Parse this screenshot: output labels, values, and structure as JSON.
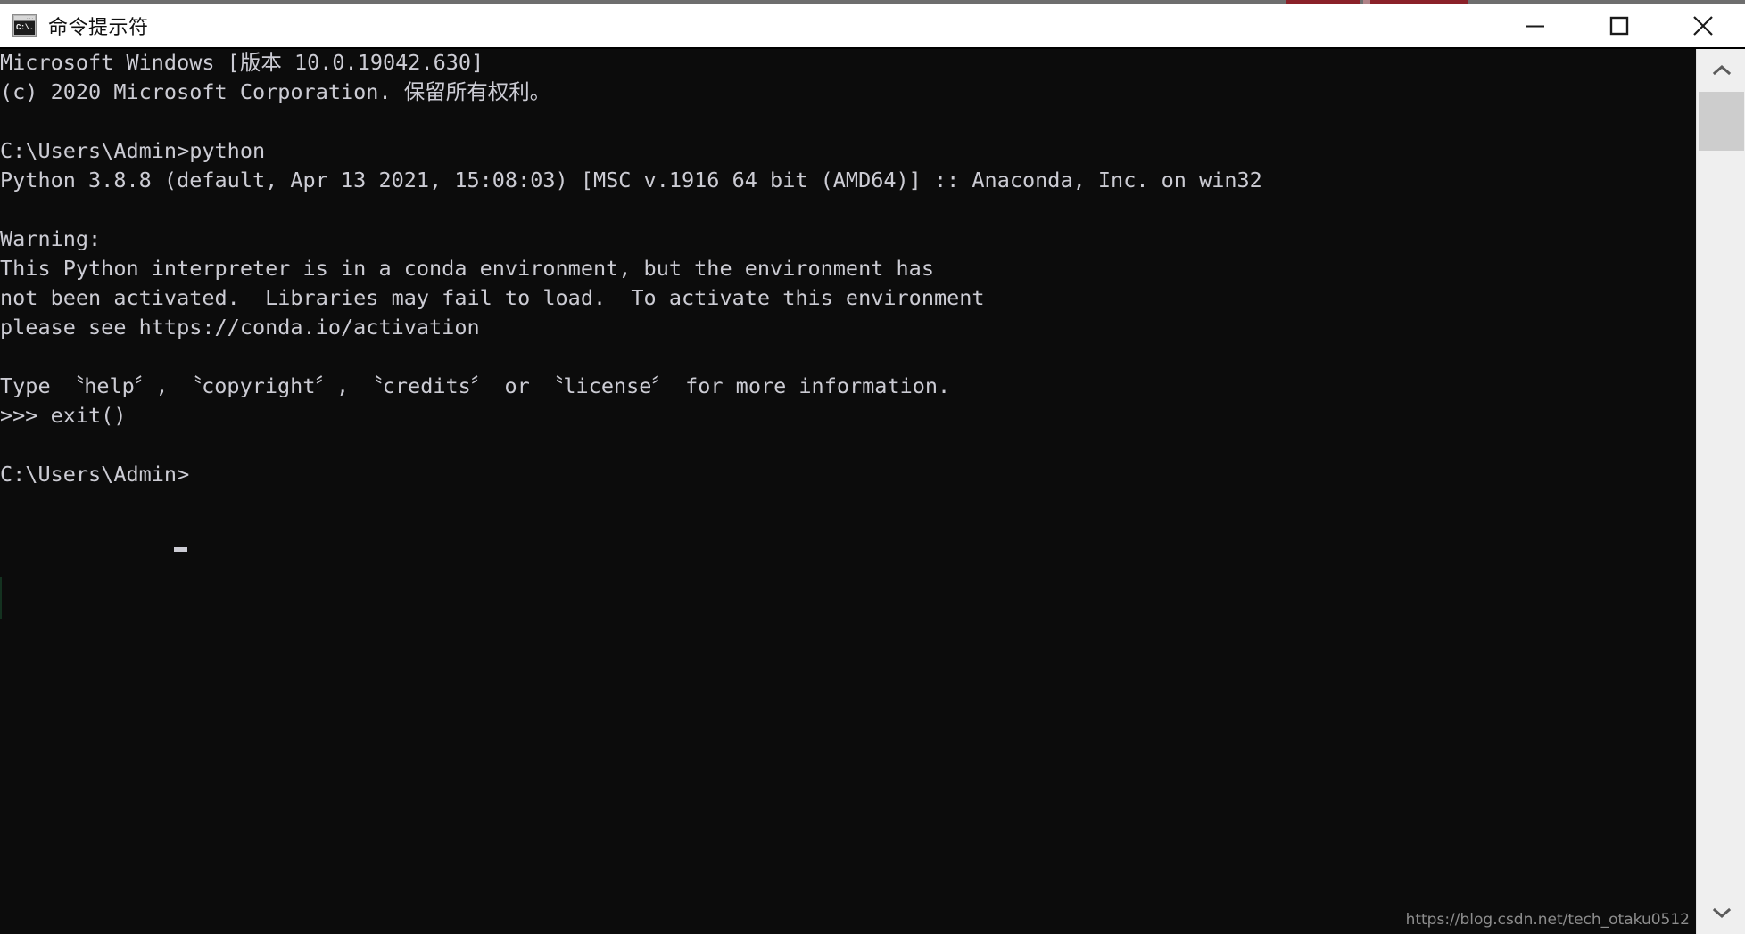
{
  "window": {
    "title": "命令提示符",
    "icon": "command-prompt-icon",
    "icon_text": "C:\\.",
    "controls": {
      "minimize_label": "最小化",
      "maximize_label": "最大化",
      "close_label": "关闭"
    }
  },
  "console": {
    "background_color": "#0c0c0c",
    "foreground_color": "#ccccd4",
    "cursor": "_",
    "lines": [
      "Microsoft Windows [版本 10.0.19042.630]",
      "(c) 2020 Microsoft Corporation. 保留所有权利。",
      "",
      "C:\\Users\\Admin>python",
      "Python 3.8.8 (default, Apr 13 2021, 15:08:03) [MSC v.1916 64 bit (AMD64)] :: Anaconda, Inc. on win32",
      "",
      "Warning:",
      "This Python interpreter is in a conda environment, but the environment has",
      "not been activated.  Libraries may fail to load.  To activate this environment",
      "please see https://conda.io/activation",
      "",
      "Type 〝help〞, 〝copyright〞, 〝credits〞 or 〝license〞 for more information.",
      ">>> exit()",
      "",
      "C:\\Users\\Admin>"
    ],
    "text": "Microsoft Windows [版本 10.0.19042.630]\n(c) 2020 Microsoft Corporation. 保留所有权利。\n\nC:\\Users\\Admin>python\nPython 3.8.8 (default, Apr 13 2021, 15:08:03) [MSC v.1916 64 bit (AMD64)] :: Anaconda, Inc. on win32\n\nWarning:\nThis Python interpreter is in a conda environment, but the environment has\nnot been activated.  Libraries may fail to load.  To activate this environment\nplease see https://conda.io/activation\n\nType 〝help〞, 〝copyright〞, 〝credits〞 or 〝license〞 for more information.\n>>> exit()\n\nC:\\Users\\Admin>"
  },
  "scrollbar": {
    "up_arrow": "scroll-up-arrow",
    "down_arrow": "scroll-down-arrow",
    "thumb_color": "#cdcdcd",
    "track_color": "#efefef"
  },
  "watermark": {
    "text": "https://blog.csdn.net/tech_otaku0512"
  }
}
